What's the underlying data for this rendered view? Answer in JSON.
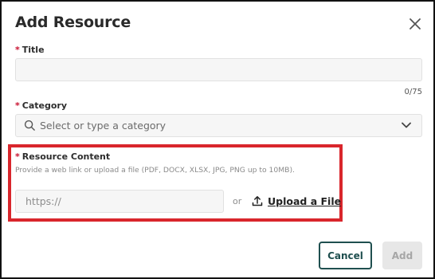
{
  "dialog": {
    "title": "Add Resource",
    "close_icon": "close-icon"
  },
  "fields": {
    "title": {
      "required_marker": "*",
      "label": "Title",
      "value": "",
      "counter": "0/75"
    },
    "category": {
      "required_marker": "*",
      "label": "Category",
      "placeholder": "Select or type a category",
      "leading_icon": "search-icon",
      "trailing_icon": "chevron-down-icon"
    },
    "resource_content": {
      "required_marker": "*",
      "label": "Resource Content",
      "helper": "Provide a web link or upload a file (PDF, DOCX, XLSX, JPG, PNG up to 10MB).",
      "url_placeholder": "https://",
      "or_text": "or",
      "upload_icon": "upload-icon",
      "upload_label": "Upload a File"
    }
  },
  "buttons": {
    "cancel": "Cancel",
    "add": "Add"
  },
  "colors": {
    "highlight_border": "#d9262c",
    "required": "#c8102e",
    "primary_teal": "#1f4f4f",
    "disabled_bg": "#e7e7e7"
  }
}
